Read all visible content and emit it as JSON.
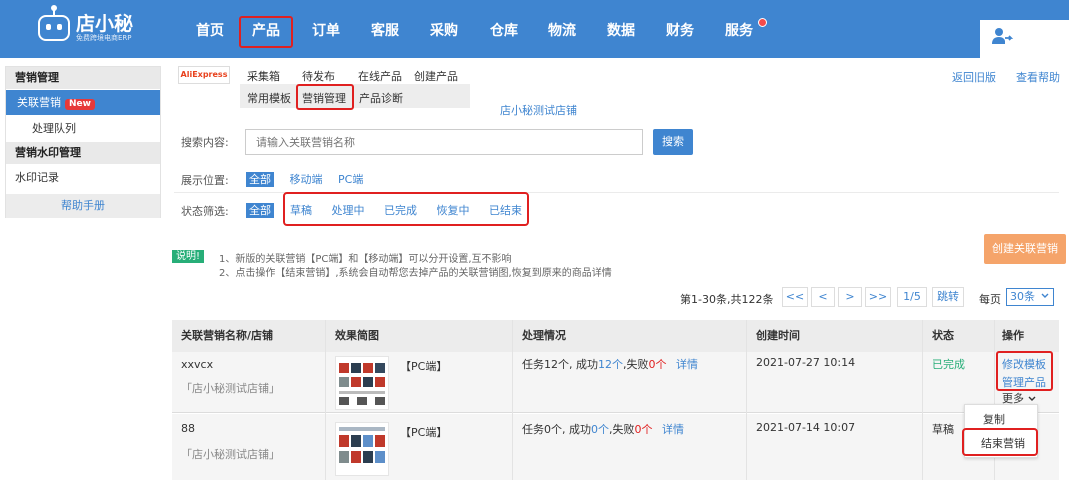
{
  "brand": {
    "name": "店小秘",
    "slogan": "免费跨境电商ERP"
  },
  "nav": {
    "items": [
      "首页",
      "产品",
      "订单",
      "客服",
      "采购",
      "仓库",
      "物流",
      "数据",
      "财务",
      "服务"
    ],
    "active": "产品"
  },
  "sidebar": {
    "group1": "营销管理",
    "item_related": "关联营销",
    "badge_new": "New",
    "item_queue": "处理队列",
    "group2": "营销水印管理",
    "item_watermark": "水印记录",
    "help": "帮助手册"
  },
  "subnav": {
    "platform": "AliExpress",
    "row1": [
      "采集箱",
      "待发布",
      "在线产品",
      "创建产品"
    ],
    "row2": [
      "常用模板",
      "营销管理",
      "产品诊断"
    ],
    "active": "营销管理",
    "back_old": "返回旧版",
    "view_help": "查看帮助"
  },
  "partial_row": {
    "shop": "店小秘测试店铺"
  },
  "filters": {
    "search_label": "搜索内容:",
    "search_placeholder": "请输入关联营销名称",
    "search_button": "搜索",
    "position_label": "展示位置:",
    "position_options": [
      "全部",
      "移动端",
      "PC端"
    ],
    "status_label": "状态筛选:",
    "status_all": "全部",
    "status_options": [
      "草稿",
      "处理中",
      "已完成",
      "恢复中",
      "已结束"
    ]
  },
  "notice": {
    "tag": "说明!",
    "line1": "1、新版的关联营销【PC端】和【移动端】可以分开设置,互不影响",
    "line2": "2、点击操作【结束营销】,系统会自动帮您去掉产品的关联营销图,恢复到原来的商品详情",
    "create_button": "创建关联营销"
  },
  "pagination": {
    "summary": "第1-30条,共122条",
    "first": "<<",
    "prev": "<",
    "next": ">",
    "last": ">>",
    "page": "1/5",
    "jump": "跳转",
    "per_page_label": "每页",
    "per_page_value": "30条"
  },
  "table": {
    "headers": [
      "关联营销名称/店铺",
      "效果简图",
      "处理情况",
      "创建时间",
      "状态",
      "操作"
    ],
    "rows": [
      {
        "name": "xxvcx",
        "shop": "「店小秘测试店铺」",
        "platform": "【PC端】",
        "task_prefix": "任务12个, 成功",
        "success": "12个",
        "fail_label": ",失败",
        "fail": "0个",
        "detail": "详情",
        "created": "2021-07-27 10:14",
        "status": "已完成",
        "action1": "修改模板",
        "action2": "管理产品",
        "more": "更多"
      },
      {
        "name": "88",
        "shop": "「店小秘测试店铺」",
        "platform": "【PC端】",
        "task_prefix": "任务0个, 成功",
        "success": "0个",
        "fail_label": ",失败",
        "fail": "0个",
        "detail": "详情",
        "created": "2021-07-14 10:07",
        "status": "草稿"
      }
    ]
  },
  "dropdown": {
    "copy": "复制",
    "end": "结束营销"
  },
  "colors": {
    "primary": "#3f85d0",
    "highlight": "#e02020",
    "success": "#27ae78",
    "accent": "#f5a46a"
  }
}
